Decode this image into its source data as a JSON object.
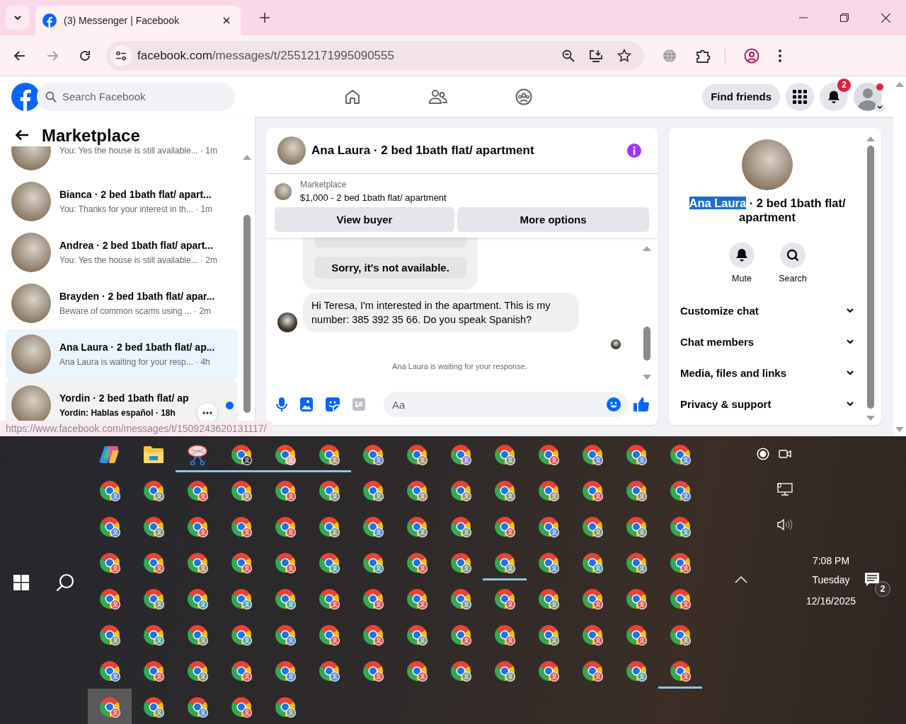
{
  "browser": {
    "tab_title": "(3) Messenger | Facebook",
    "url_host": "facebook.com",
    "url_path": "/messages/t/25512171995090555",
    "forward_disabled": true
  },
  "facebook": {
    "search_placeholder": "Search Facebook",
    "find_friends": "Find friends",
    "notification_count": "2",
    "profile_alert": true
  },
  "chat_list": {
    "title": "Marketplace",
    "chats": [
      {
        "preview": "You: Yes the house is still available...",
        "time": "· 1m",
        "selected": false,
        "hovered": false,
        "unread": false
      },
      {
        "title": "Bianca · 2 bed 1bath flat/ apart...",
        "preview": "You: Thanks for your interest in th...",
        "time": "· 1m",
        "selected": false,
        "hovered": false,
        "unread": false
      },
      {
        "title": "Andrea · 2 bed 1bath flat/ apart...",
        "preview": "You: Yes the house is still available...",
        "time": "· 2m",
        "selected": false,
        "hovered": false,
        "unread": false
      },
      {
        "title": "Brayden · 2 bed 1bath flat/ apar...",
        "preview": "Beware of common scams using ...",
        "time": "· 2m",
        "selected": false,
        "hovered": false,
        "unread": false
      },
      {
        "title": "Ana Laura · 2 bed 1bath flat/ ap...",
        "preview": "Ana Laura is waiting for your resp...",
        "time": "· 4h",
        "selected": true,
        "hovered": false,
        "unread": false
      },
      {
        "title": "Yordin · 2 bed 1bath flat/ ap",
        "preview": "Yordin: Hablas español",
        "time": "· 18h",
        "selected": false,
        "hovered": true,
        "unread": true
      }
    ]
  },
  "conversation": {
    "title": "Ana Laura · 2 bed 1bath flat/ apartment",
    "listing": {
      "source": "Marketplace",
      "price_title": "$1,000 - 2 bed 1bath flat/ apartment",
      "buttons": [
        "View buyer",
        "More options"
      ]
    },
    "messages": [
      {
        "kind": "quick_replies",
        "options": [
          "Sorry, it's not available."
        ]
      },
      {
        "kind": "incoming",
        "text": "Hi Teresa, I'm interested in the apartment. This is my number: 385 392 35 66. Do you speak Spanish?"
      }
    ],
    "status": "Ana Laura is waiting for your response.",
    "composer_placeholder": "Aa"
  },
  "details": {
    "name": "Ana Laura",
    "name_selected": true,
    "subtitle": "· 2 bed 1bath flat/ apartment",
    "actions": [
      {
        "kind": "mute",
        "label": "Mute"
      },
      {
        "kind": "search",
        "label": "Search"
      }
    ],
    "sections": [
      "Customize chat",
      "Chat members",
      "Media, files and links",
      "Privacy & support"
    ]
  },
  "status_url": "https://www.facebook.com/messages/t/1509243620131117/",
  "taskbar": {
    "rows": [
      [
        {
          "kind": "copilot",
          "running": false,
          "selected": false
        },
        {
          "kind": "folder",
          "running": false,
          "selected": false
        },
        {
          "kind": "snip",
          "running": true,
          "selected": false
        },
        {
          "kind": "chrome",
          "color": "#333338",
          "running": true,
          "selected": false
        },
        {
          "kind": "chrome",
          "color": "#e8a8a0",
          "running": true,
          "selected": false
        },
        {
          "kind": "chrome",
          "color": "#a89070",
          "running": true,
          "selected": false
        },
        {
          "kind": "chrome",
          "color": "#6d86c8",
          "running": false,
          "selected": false
        },
        {
          "kind": "chrome",
          "color": "#a89070",
          "running": false,
          "selected": false
        },
        {
          "kind": "chrome",
          "color": "#9b7fd0",
          "running": false,
          "selected": false
        },
        {
          "kind": "chrome",
          "color": "#7d9b7d",
          "running": false,
          "selected": false
        },
        {
          "kind": "chrome",
          "color": "#e05a4f",
          "running": false,
          "selected": false
        },
        {
          "kind": "chrome",
          "color": "#6d86c8",
          "running": false,
          "selected": false
        },
        {
          "kind": "chrome",
          "color": "#5b8fd6",
          "running": false,
          "selected": false
        },
        {
          "kind": "chrome",
          "color": "#5b8fd6",
          "running": false,
          "selected": false
        }
      ],
      [
        {
          "kind": "chrome",
          "color": "#5b8fd6",
          "running": false,
          "selected": false
        },
        {
          "kind": "chrome",
          "color": "#7d9b7d",
          "running": false,
          "selected": false
        },
        {
          "kind": "chrome",
          "color": "#e05a4f",
          "running": false,
          "selected": false
        },
        {
          "kind": "chrome",
          "color": "#a89070",
          "running": false,
          "selected": false
        },
        {
          "kind": "chrome",
          "color": "#e05a4f",
          "running": false,
          "selected": false
        },
        {
          "kind": "chrome",
          "color": "#7d9b7d",
          "running": false,
          "selected": false
        },
        {
          "kind": "chrome",
          "color": "#7d9b7d",
          "running": false,
          "selected": false
        },
        {
          "kind": "chrome",
          "color": "#a89070",
          "running": false,
          "selected": false
        },
        {
          "kind": "chrome",
          "color": "#a89070",
          "running": false,
          "selected": false
        },
        {
          "kind": "chrome",
          "color": "#7d9b7d",
          "running": false,
          "selected": false
        },
        {
          "kind": "chrome",
          "color": "#a89070",
          "running": false,
          "selected": false
        },
        {
          "kind": "chrome",
          "color": "#e05a4f",
          "running": false,
          "selected": false
        },
        {
          "kind": "chrome",
          "color": "#a89070",
          "running": false,
          "selected": false
        },
        {
          "kind": "chrome",
          "color": "#5b8fd6",
          "running": false,
          "selected": false
        }
      ],
      [
        {
          "kind": "chrome",
          "color": "#5b8fd6",
          "running": false,
          "selected": false
        },
        {
          "kind": "chrome",
          "color": "#7d9b7d",
          "running": false,
          "selected": false
        },
        {
          "kind": "chrome",
          "color": "#e05a4f",
          "running": false,
          "selected": false
        },
        {
          "kind": "chrome",
          "color": "#e05a4f",
          "running": false,
          "selected": false
        },
        {
          "kind": "chrome",
          "color": "#e05a4f",
          "running": false,
          "selected": false
        },
        {
          "kind": "chrome",
          "color": "#7d9b7d",
          "running": false,
          "selected": false
        },
        {
          "kind": "chrome",
          "color": "#5b8fd6",
          "running": false,
          "selected": false
        },
        {
          "kind": "chrome",
          "color": "#7d9b7d",
          "running": false,
          "selected": false
        },
        {
          "kind": "chrome",
          "color": "#7d9b7d",
          "running": false,
          "selected": false
        },
        {
          "kind": "chrome",
          "color": "#e05a4f",
          "running": false,
          "selected": false
        },
        {
          "kind": "chrome",
          "color": "#5b8fd6",
          "running": false,
          "selected": false
        },
        {
          "kind": "chrome",
          "color": "#7d9b7d",
          "running": false,
          "selected": false
        },
        {
          "kind": "chrome",
          "color": "#7d9b7d",
          "running": false,
          "selected": false
        },
        {
          "kind": "chrome",
          "color": "#4fa8a8",
          "running": false,
          "selected": false
        }
      ],
      [
        {
          "kind": "chrome",
          "color": "#e05a4f",
          "running": false,
          "selected": false
        },
        {
          "kind": "chrome",
          "color": "#e05a4f",
          "running": false,
          "selected": false
        },
        {
          "kind": "chrome",
          "color": "#a89070",
          "running": false,
          "selected": false
        },
        {
          "kind": "chrome",
          "color": "#e05a4f",
          "running": false,
          "selected": false
        },
        {
          "kind": "chrome",
          "color": "#e05a4f",
          "running": false,
          "selected": false
        },
        {
          "kind": "chrome",
          "color": "#4fa8a8",
          "running": false,
          "selected": false
        },
        {
          "kind": "chrome",
          "color": "#4fa8a8",
          "running": false,
          "selected": false
        },
        {
          "kind": "chrome",
          "color": "#e05a4f",
          "running": false,
          "selected": false
        },
        {
          "kind": "chrome",
          "color": "#7d9b7d",
          "running": false,
          "selected": false
        },
        {
          "kind": "chrome",
          "color": "#8a9a8a",
          "running": true,
          "selected": false
        },
        {
          "kind": "chrome",
          "color": "#5b8fd6",
          "running": false,
          "selected": false
        },
        {
          "kind": "chrome",
          "color": "#4fa8a8",
          "running": false,
          "selected": false
        },
        {
          "kind": "chrome",
          "color": "#7d9b7d",
          "running": false,
          "selected": false
        },
        {
          "kind": "chrome",
          "color": "#e05a4f",
          "running": false,
          "selected": false
        }
      ],
      [
        {
          "kind": "chrome",
          "color": "#e05a4f",
          "running": false,
          "selected": false
        },
        {
          "kind": "chrome",
          "color": "#7d9b7d",
          "running": false,
          "selected": false
        },
        {
          "kind": "chrome",
          "color": "#4fa8a8",
          "running": false,
          "selected": false
        },
        {
          "kind": "chrome",
          "color": "#4fa8a8",
          "running": false,
          "selected": false
        },
        {
          "kind": "chrome",
          "color": "#4fa8a8",
          "running": false,
          "selected": false
        },
        {
          "kind": "chrome",
          "color": "#e05a4f",
          "running": false,
          "selected": false
        },
        {
          "kind": "chrome",
          "color": "#e05a4f",
          "running": false,
          "selected": false
        },
        {
          "kind": "chrome",
          "color": "#e05a4f",
          "running": false,
          "selected": false
        },
        {
          "kind": "chrome",
          "color": "#7d9b7d",
          "running": false,
          "selected": false
        },
        {
          "kind": "chrome",
          "color": "#e05a4f",
          "running": false,
          "selected": false
        },
        {
          "kind": "chrome",
          "color": "#7d9b7d",
          "running": false,
          "selected": false
        },
        {
          "kind": "chrome",
          "color": "#e05a4f",
          "running": false,
          "selected": false
        },
        {
          "kind": "chrome",
          "color": "#e05a4f",
          "running": false,
          "selected": false
        },
        {
          "kind": "chrome",
          "color": "#e05a4f",
          "running": false,
          "selected": false
        }
      ],
      [
        {
          "kind": "chrome",
          "color": "#7d9b7d",
          "running": false,
          "selected": false
        },
        {
          "kind": "chrome",
          "color": "#4fa8a8",
          "running": false,
          "selected": false
        },
        {
          "kind": "chrome",
          "color": "#7d9b7d",
          "running": false,
          "selected": false
        },
        {
          "kind": "chrome",
          "color": "#4fa8a8",
          "running": false,
          "selected": false
        },
        {
          "kind": "chrome",
          "color": "#5b8fd6",
          "running": false,
          "selected": false
        },
        {
          "kind": "chrome",
          "color": "#e05a4f",
          "running": false,
          "selected": false
        },
        {
          "kind": "chrome",
          "color": "#e05a4f",
          "running": false,
          "selected": false
        },
        {
          "kind": "chrome",
          "color": "#7d9b7d",
          "running": false,
          "selected": false
        },
        {
          "kind": "chrome",
          "color": "#e05a4f",
          "running": false,
          "selected": false
        },
        {
          "kind": "chrome",
          "color": "#e05a4f",
          "running": false,
          "selected": false
        },
        {
          "kind": "chrome",
          "color": "#7d9b7d",
          "running": false,
          "selected": false
        },
        {
          "kind": "chrome",
          "color": "#e05a4f",
          "running": false,
          "selected": false
        },
        {
          "kind": "chrome",
          "color": "#e05a4f",
          "running": false,
          "selected": false
        },
        {
          "kind": "chrome",
          "color": "#a89070",
          "running": false,
          "selected": false
        }
      ],
      [
        {
          "kind": "chrome",
          "color": "#5b8fd6",
          "running": false,
          "selected": false
        },
        {
          "kind": "chrome",
          "color": "#e05a4f",
          "running": false,
          "selected": false
        },
        {
          "kind": "chrome",
          "color": "#7d9b7d",
          "running": false,
          "selected": false
        },
        {
          "kind": "chrome",
          "color": "#e05a4f",
          "running": false,
          "selected": false
        },
        {
          "kind": "chrome",
          "color": "#5b8fd6",
          "running": false,
          "selected": false
        },
        {
          "kind": "chrome",
          "color": "#5b8fd6",
          "running": false,
          "selected": false
        },
        {
          "kind": "chrome",
          "color": "#e05a4f",
          "running": false,
          "selected": false
        },
        {
          "kind": "chrome",
          "color": "#e05a4f",
          "running": false,
          "selected": false
        },
        {
          "kind": "chrome",
          "color": "#7d9b7d",
          "running": false,
          "selected": false
        },
        {
          "kind": "chrome",
          "color": "#7d9b7d",
          "running": false,
          "selected": false
        },
        {
          "kind": "chrome",
          "color": "#e05a4f",
          "running": false,
          "selected": false
        },
        {
          "kind": "chrome",
          "color": "#e05a4f",
          "running": false,
          "selected": false
        },
        {
          "kind": "chrome",
          "color": "#4fa8a8",
          "running": false,
          "selected": false
        },
        {
          "kind": "chrome",
          "color": "#e05a4f",
          "running": true,
          "selected": false
        }
      ],
      [
        {
          "kind": "chrome",
          "color": "#e05a4f",
          "running": false,
          "selected": true
        },
        {
          "kind": "chrome",
          "color": "#7d9b7d",
          "running": false,
          "selected": false
        },
        {
          "kind": "chrome",
          "color": "#5b8fd6",
          "running": false,
          "selected": false
        },
        {
          "kind": "chrome",
          "color": "#e05a4f",
          "running": false,
          "selected": false
        },
        {
          "kind": "chrome",
          "color": "#7d9b7d",
          "running": false,
          "selected": false
        }
      ]
    ],
    "tray": {
      "time": "7:08 PM",
      "day": "Tuesday",
      "date": "12/16/2025",
      "notification_count": "2"
    }
  }
}
